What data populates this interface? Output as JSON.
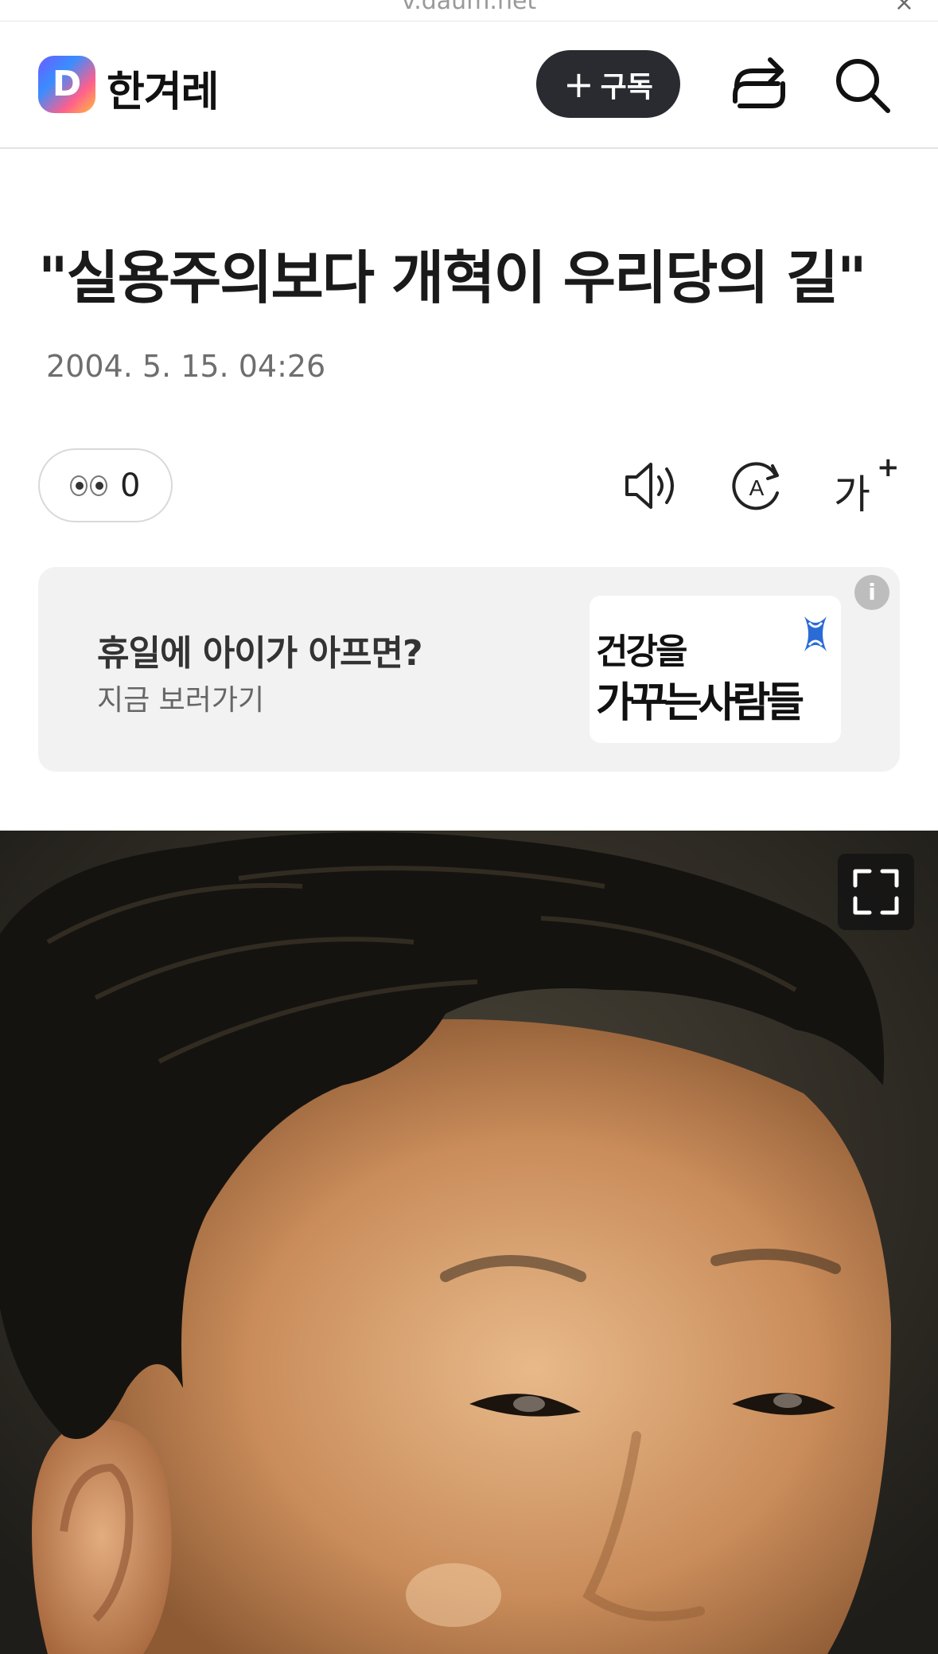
{
  "browser": {
    "url": "v.daum.net",
    "close_glyph": "×"
  },
  "header": {
    "logo_letter": "D",
    "brand": "한겨레",
    "subscribe_plus": "+",
    "subscribe_label": "구독",
    "icons": [
      "share-icon",
      "search-icon"
    ]
  },
  "article": {
    "title": "\"실용주의보다 개혁이 우리당의 길\"",
    "date": "2004. 5. 15. 04:26",
    "reaction_count": "0",
    "reaction_icon": "eyes-emoji-icon",
    "tools": {
      "speaker_icon": "speaker-icon",
      "translate_icon": "translate-icon",
      "fontsize_label": "가",
      "fontsize_plus": "+"
    }
  },
  "ad": {
    "headline": "휴일에 아이가 아프면?",
    "sub": "지금 보러가기",
    "logo_line1": "건강을",
    "logo_line2": "가꾸는사람들",
    "info_glyph": "i",
    "mark_color": "#2b6bd6"
  },
  "photo": {
    "fullscreen_icon": "fullscreen-icon"
  }
}
